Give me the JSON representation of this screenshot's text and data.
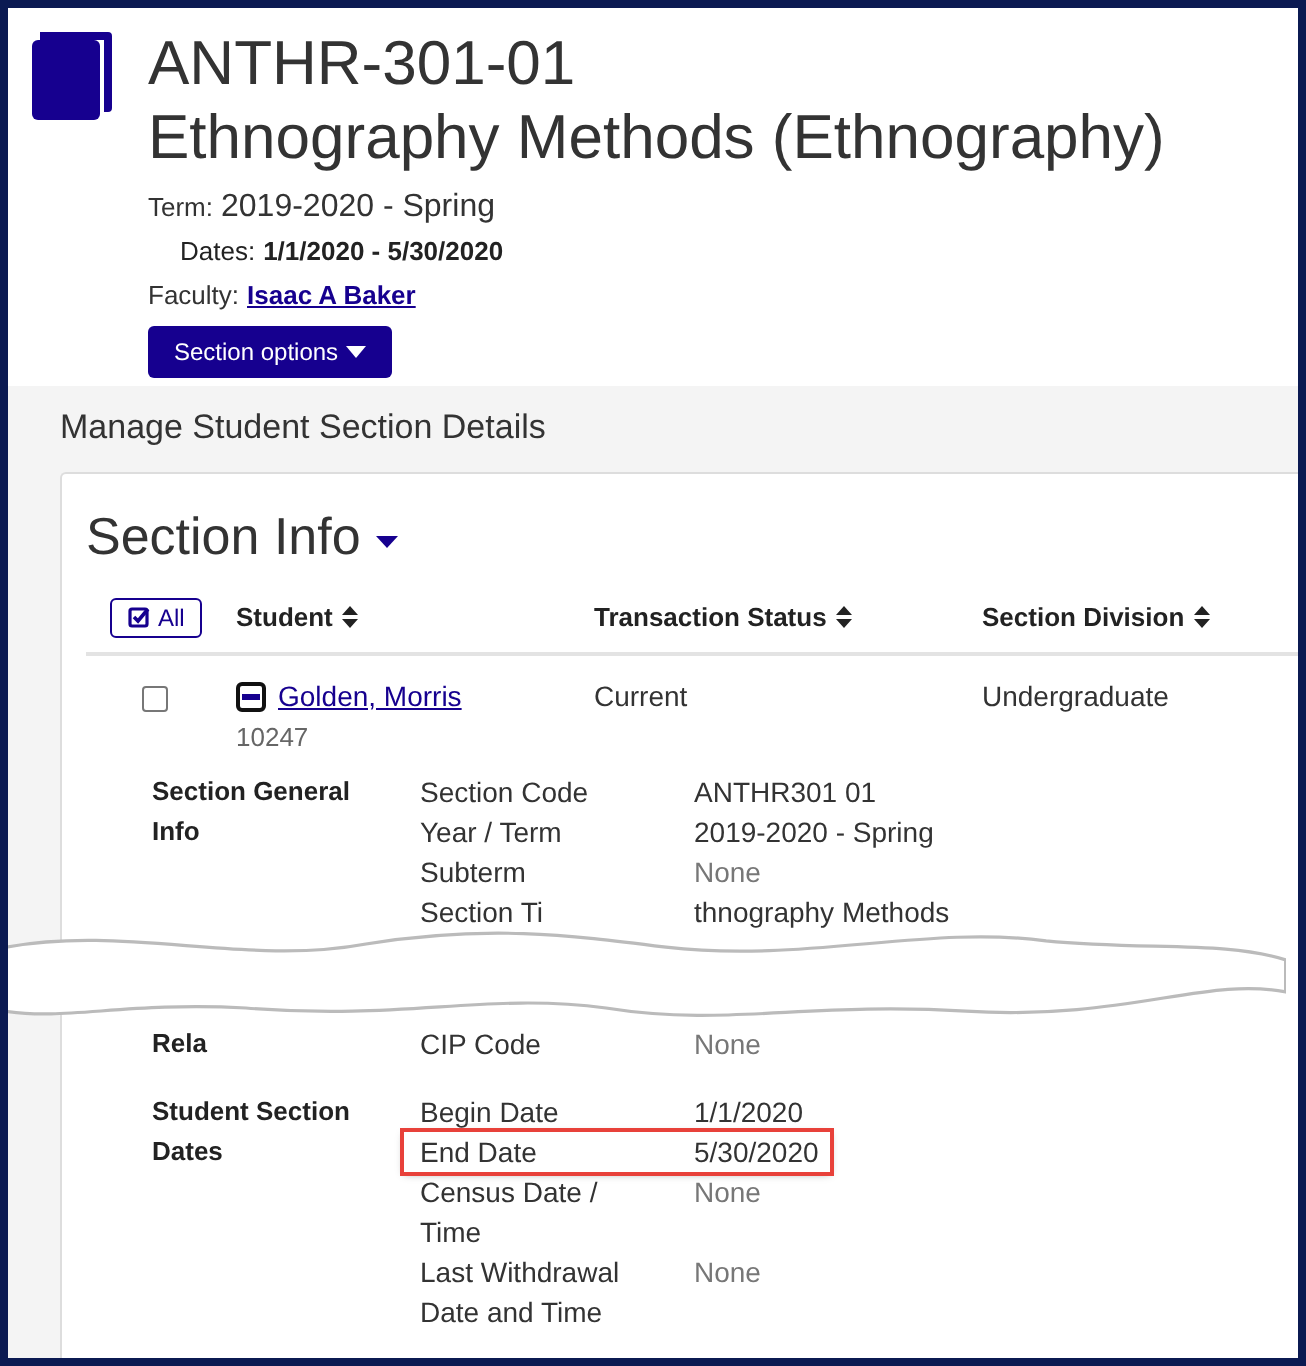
{
  "header": {
    "code": "ANTHR-301-01",
    "name": "Ethnography Methods (Ethnography)",
    "term_label": "Term:",
    "term_value": "2019-2020 - Spring",
    "dates_label": "Dates:",
    "dates_value": "1/1/2020 - 5/30/2020",
    "faculty_label": "Faculty:",
    "faculty_value": "Isaac A Baker",
    "options_button": "Section options"
  },
  "panel_title": "Manage Student Section Details",
  "card": {
    "heading": "Section Info",
    "all_button": "All",
    "columns": [
      "Student",
      "Transaction Status",
      "Section Division"
    ],
    "rows": [
      {
        "checked": false,
        "expanded": true,
        "name": "Golden, Morris",
        "id": "10247",
        "status": "Current",
        "division": "Undergraduate"
      }
    ],
    "details_before_break": [
      {
        "heading": "Section General Info",
        "fields": [
          {
            "label": "Section Code",
            "value": "ANTHR301 01",
            "muted": false,
            "highlighted": false
          },
          {
            "label": "Year / Term",
            "value": "2019-2020 - Spring",
            "muted": false,
            "highlighted": false
          },
          {
            "label": "Subterm",
            "value": "None",
            "muted": true,
            "highlighted": false
          },
          {
            "label": "Section Ti",
            "value": "thnography Methods",
            "muted": false,
            "highlighted": false
          }
        ]
      }
    ],
    "details_after_break": [
      {
        "heading": "Rela",
        "fields": [
          {
            "label": "CIP Code",
            "value": "None",
            "muted": true,
            "highlighted": false
          }
        ]
      },
      {
        "heading": "Student Section Dates",
        "fields": [
          {
            "label": "Begin Date",
            "value": "1/1/2020",
            "muted": false,
            "highlighted": false
          },
          {
            "label": "End Date",
            "value": "5/30/2020",
            "muted": false,
            "highlighted": true
          },
          {
            "label": "Census Date / Time",
            "value": "None",
            "muted": true,
            "highlighted": false
          },
          {
            "label": "Last Withdrawal Date and Time",
            "value": "None",
            "muted": true,
            "highlighted": false
          }
        ]
      }
    ]
  }
}
